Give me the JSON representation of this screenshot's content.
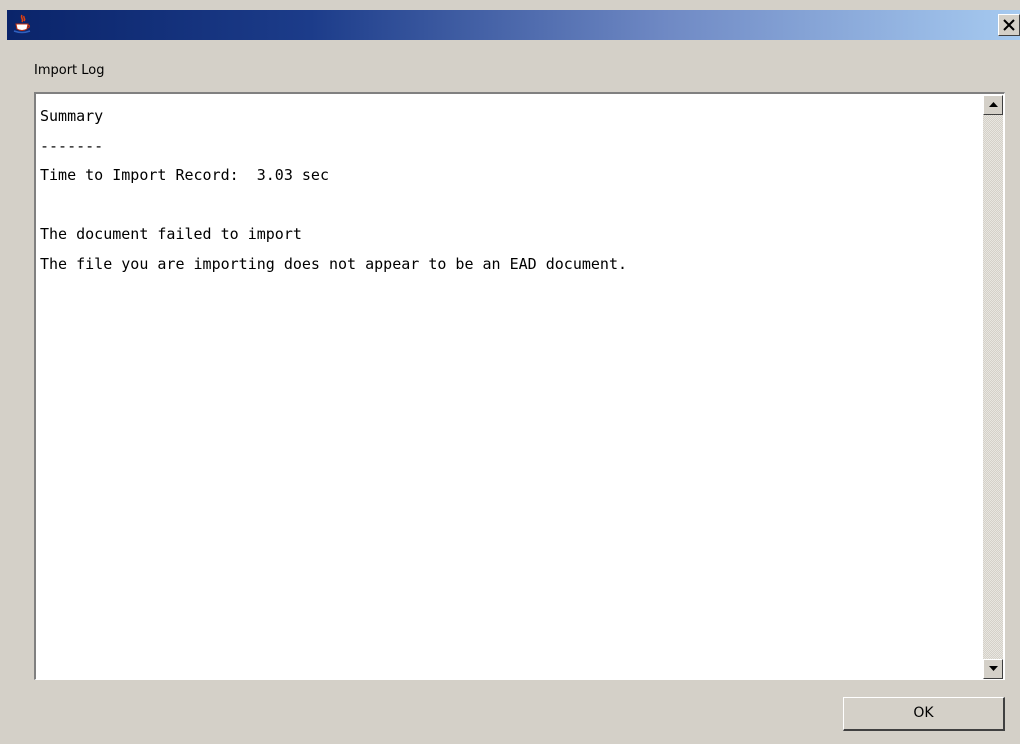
{
  "window": {
    "title": "",
    "icon": "java-cup-icon",
    "close_icon": "close-icon",
    "title_gradient": [
      "#0a246a",
      "#a6caf0"
    ]
  },
  "dialog": {
    "group_label": "Import Log",
    "log_text": "Summary\n-------\nTime to Import Record:  3.03 sec\n\nThe document failed to import\nThe file you are importing does not appear to be an EAD document.",
    "scrollbar": {
      "up_icon": "arrow-up-icon",
      "down_icon": "arrow-down-icon"
    },
    "ok_label": "OK"
  }
}
